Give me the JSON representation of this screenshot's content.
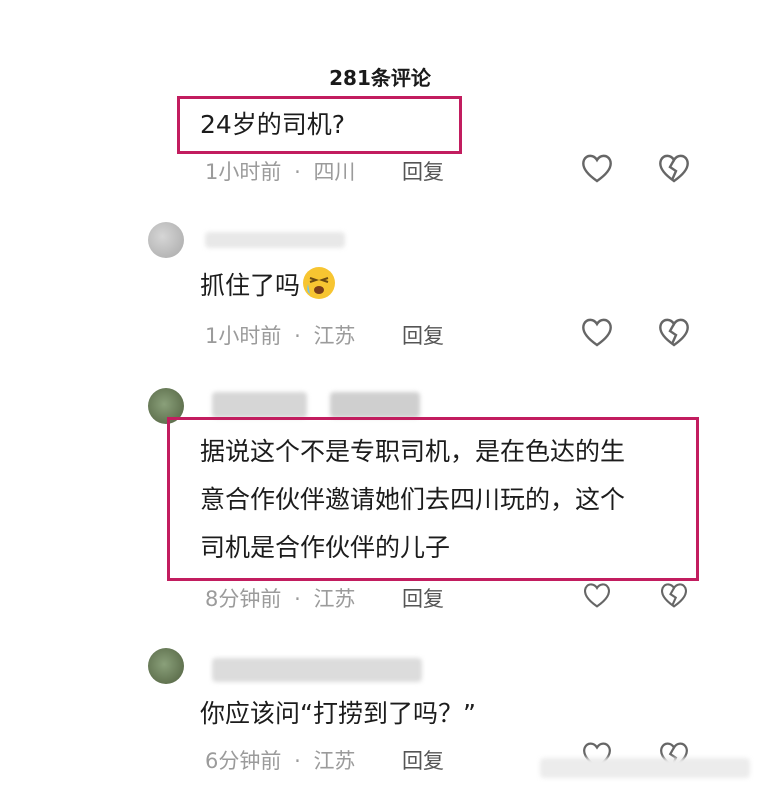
{
  "header": {
    "title": "281条评论"
  },
  "comments": [
    {
      "text": "24岁的司机?",
      "time": "1小时前",
      "location": "四川",
      "reply_label": "回复"
    },
    {
      "text": "抓住了吗",
      "emoji": "crying-face-emoji",
      "time": "1小时前",
      "location": "江苏",
      "reply_label": "回复"
    },
    {
      "lines": [
        "据说这个不是专职司机，是在色达的生",
        "意合作伙伴邀请她们去四川玩的，这个",
        "司机是合作伙伴的儿子"
      ],
      "time": "8分钟前",
      "location": "江苏",
      "reply_label": "回复"
    },
    {
      "text": "你应该问“打捞到了吗？”",
      "time": "6分钟前",
      "location": "江苏",
      "reply_label": "回复"
    }
  ],
  "meta_separator": "·",
  "icons": {
    "like": "heart-icon",
    "dislike": "broken-heart-icon"
  },
  "colors": {
    "highlight": "#c21d5f",
    "meta": "#9b9b9b"
  }
}
